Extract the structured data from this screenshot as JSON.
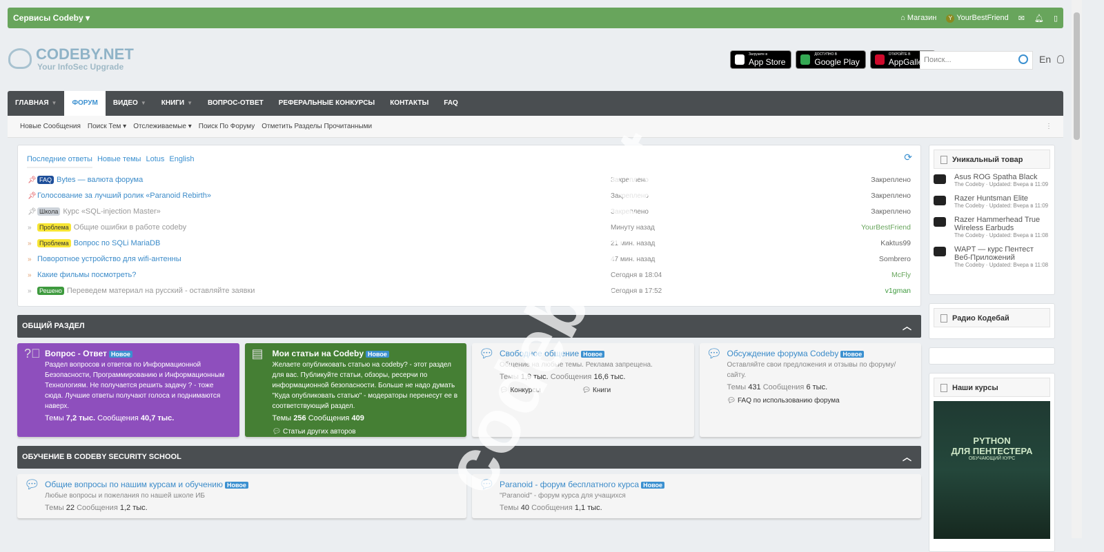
{
  "topbar": {
    "services": "Сервисы Codeby",
    "shop": "Магазин",
    "user": "YourBestFriend",
    "avatar_letter": "Y"
  },
  "logo": {
    "name": "CODEBY.NET",
    "tagline": "Your InfoSec Upgrade"
  },
  "stores": [
    {
      "small": "Загрузите в",
      "big": "App Store",
      "color": "#ffffff"
    },
    {
      "small": "ДОСТУПНО В",
      "big": "Google Play",
      "color": "#34a853"
    },
    {
      "small": "ОТКРОЙТЕ В",
      "big": "AppGallery",
      "color": "#cf0a2c"
    }
  ],
  "search": {
    "placeholder": "Поиск..."
  },
  "lang": "En",
  "nav": [
    {
      "label": "Главная",
      "dd": true
    },
    {
      "label": "Форум",
      "active": true
    },
    {
      "label": "Видео",
      "dd": true
    },
    {
      "label": "Книги",
      "dd": true
    },
    {
      "label": "Вопрос-ответ"
    },
    {
      "label": "Реферальные конкурсы"
    },
    {
      "label": "Контакты"
    },
    {
      "label": "FAQ"
    }
  ],
  "subnav": [
    "Новые Сообщения",
    "Поиск Тем ▾",
    "Отслеживаемые ▾",
    "Поиск По Форуму",
    "Отметить Разделы Прочитанными"
  ],
  "recent": {
    "tabs": [
      "Последние ответы",
      "Новые темы",
      "Lotus",
      "English"
    ],
    "rows": [
      {
        "icon": "pin",
        "label": "FAQ",
        "label_bg": "#1d4e99",
        "label_fg": "#fff",
        "title": "Bytes — валюта форума",
        "time": "Закреплено",
        "user": "Закреплено",
        "pin_color": "#d9242b"
      },
      {
        "icon": "pin",
        "title": "Голосование за лучший ролик «Paranoid Rebirth»",
        "time": "Закреплено",
        "user": "Закреплено",
        "pin_color": "#d9242b"
      },
      {
        "icon": "pin",
        "label": "Школа",
        "label_bg": "#cdd3da",
        "label_fg": "#333",
        "title": "Курс «SQL-injection Master»",
        "read": true,
        "time": "Закреплено",
        "user": "Закреплено",
        "pin_color": "#888"
      },
      {
        "icon": "chevron",
        "label": "Проблема",
        "label_bg": "#f7e534",
        "label_fg": "#333",
        "title": "Общие ошибки в работе codeby",
        "read": true,
        "time": "Минуту назад",
        "user": "YourBestFriend",
        "user_color": "#68a55c"
      },
      {
        "icon": "chevron",
        "label": "Проблема",
        "label_bg": "#f7e534",
        "label_fg": "#333",
        "title": "Вопрос по SQLi MariaDB",
        "time": "21 мин. назад",
        "user": "Kaktus99"
      },
      {
        "icon": "chevron",
        "title": "Поворотное устройство для wifi-антенны",
        "time": "47 мин. назад",
        "user": "Sombrero"
      },
      {
        "icon": "chevron",
        "title": "Какие фильмы посмотреть?",
        "time": "Сегодня в 18:04",
        "user": "McFly",
        "user_color": "#68a55c"
      },
      {
        "icon": "chevron",
        "label": "Решено",
        "label_bg": "#3e9a3e",
        "label_fg": "#fff",
        "title": "Переведем материал на русский - оставляйте заявки",
        "read": true,
        "time": "Сегодня в 17:52",
        "user": "v1gman",
        "user_color": "#3e9a3e"
      }
    ]
  },
  "sections": [
    {
      "title": "Общий раздел",
      "cards": [
        {
          "title": "Вопрос - Ответ",
          "badge": "Новое",
          "desc": "Раздел вопросов и ответов по Информационной Безопасности, Программированию и Информационным Технологиям. Не получается решить задачу ? - тоже сюда. Лучшие ответы получают голоса и поднимаются наверх.",
          "threads_label": "Темы",
          "threads": "7,2 тыс.",
          "posts_label": "Сообщения",
          "posts": "40,7 тыс.",
          "bg": "#8e4fbd",
          "icon": "question-icon"
        },
        {
          "title": "Мои статьи на Codeby",
          "badge": "Новое",
          "desc": "Желаете опубликовать статью на codeby? - этот раздел для вас. Публикуйте статьи, обзоры, ресерчи по информационной безопасности. Больше не надо думать \"Куда опубликовать статью\" - модераторы перенесут ее в соответствующий раздел.",
          "threads_label": "Темы",
          "threads": "256",
          "posts_label": "Сообщения",
          "posts": "409",
          "subforums": [
            "Статьи других авторов"
          ],
          "bg": "#457f34",
          "icon": "document-icon"
        },
        {
          "title": "Свободное общение",
          "badge": "Новое",
          "desc": "Общение на любые темы. Реклама запрещена.",
          "threads_label": "Темы",
          "threads": "1,9 тыс.",
          "posts_label": "Сообщения",
          "posts": "16,6 тыс.",
          "subforums": [
            "Конкурсы",
            "Книги"
          ],
          "icon": "chat-icon"
        },
        {
          "title": "Обсуждение форума Codeby",
          "badge": "Новое",
          "desc": "Оставляйте свои предложения и отзывы по форуму/сайту.",
          "threads_label": "Темы",
          "threads": "431",
          "posts_label": "Сообщения",
          "posts": "6 тыс.",
          "subforums": [
            "FAQ по использованию форума"
          ],
          "icon": "chat-icon"
        }
      ]
    },
    {
      "title": "Обучение в Codeby Security School",
      "cards": [
        {
          "title": "Общие вопросы по нашим курсам и обучению",
          "badge": "Новое",
          "desc": "Любые вопросы и пожелания по нашей школе ИБ",
          "threads_label": "Темы",
          "threads": "22",
          "posts_label": "Сообщения",
          "posts": "1,2 тыс.",
          "icon": "chat-icon"
        },
        {
          "title": "Paranoid - форум бесплатного курса",
          "badge": "Новое",
          "desc": "\"Paranoid\" - форум курса для учащихся",
          "threads_label": "Темы",
          "threads": "40",
          "posts_label": "Сообщения",
          "posts": "1,1 тыс.",
          "icon": "chat-icon"
        }
      ]
    }
  ],
  "sidebar": {
    "unique_title": "Уникальный товар",
    "products": [
      {
        "name": "Asus ROG Spatha Black",
        "meta": "The Codeby · Updated: Вчера в 11:09"
      },
      {
        "name": "Razer Huntsman Elite",
        "meta": "The Codeby · Updated: Вчера в 11:09"
      },
      {
        "name": "Razer Hammerhead True Wireless Earbuds",
        "meta": "The Codeby · Updated: Вчера в 11:08"
      },
      {
        "name": "WAPT — курс Пентест Веб-Приложений",
        "meta": "The Codeby · Updated: Вчера в 11:08"
      }
    ],
    "radio_title": "Радио Кодебай",
    "courses_title": "Наши курсы",
    "course_banner": {
      "title1": "PYTHON",
      "title2": "ДЛЯ ПЕНТЕСТЕРА",
      "subtitle": "ОБУЧАЮЩИЙ КУРС"
    }
  },
  "watermark": "codeby.net"
}
